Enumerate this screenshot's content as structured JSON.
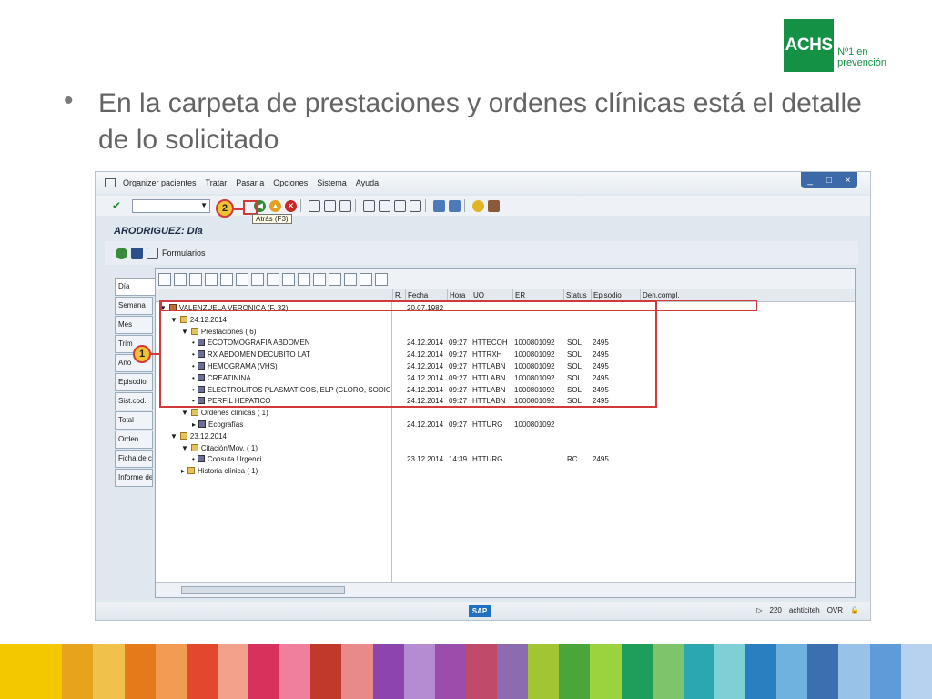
{
  "logo": {
    "mark": "ACHS",
    "line1": "Nº1 en",
    "line2": "prevención"
  },
  "slide": {
    "bullet": "•",
    "text": "En la carpeta de prestaciones y ordenes clínicas está el detalle de lo solicitado"
  },
  "sap": {
    "menu": [
      "Organizer pacientes",
      "Tratar",
      "Pasar a",
      "Opciones",
      "Sistema",
      "Ayuda"
    ],
    "window_controls": [
      "_",
      "□",
      "×"
    ],
    "tooltip": "Atrás   (F3)",
    "title": "ARODRIGUEZ: Día",
    "formularios": "Formularios",
    "markers": {
      "one": "1",
      "two": "2"
    },
    "tabs": [
      "Día",
      "Semana",
      "Mes",
      "Trim",
      "Año",
      "Episodio",
      "Sist.cod.",
      "Total",
      "Orden",
      "Ficha de c",
      "Informe de"
    ],
    "columns": [
      "R.",
      "Fecha",
      "Hora",
      "UO",
      "ER",
      "Status",
      "Episodio",
      "Den.compl."
    ],
    "rows": [
      {
        "indent": 0,
        "icon": "patient",
        "arrow": "▼",
        "label": "VALENZUELA VERONICA (F, 32)",
        "fecha": "20.07.1982",
        "hora": "",
        "uo": "",
        "er": "",
        "status": "",
        "episodio": ""
      },
      {
        "indent": 1,
        "icon": "folder",
        "arrow": "▼",
        "label": "24.12.2014",
        "fecha": "",
        "hora": "",
        "uo": "",
        "er": "",
        "status": "",
        "episodio": ""
      },
      {
        "indent": 2,
        "icon": "folder",
        "arrow": "▼",
        "label": "Prestaciones (  6)",
        "fecha": "",
        "hora": "",
        "uo": "",
        "er": "",
        "status": "",
        "episodio": ""
      },
      {
        "indent": 3,
        "icon": "doc",
        "arrow": "•",
        "label": "ECOTOMOGRAFIA ABDOMEN",
        "fecha": "24.12.2014",
        "hora": "09:27",
        "uo": "HTTECOH",
        "er": "1000801092",
        "status": "SOL",
        "episodio": "2495"
      },
      {
        "indent": 3,
        "icon": "doc",
        "arrow": "•",
        "label": "RX ABDOMEN DECUBITO LAT",
        "fecha": "24.12.2014",
        "hora": "09:27",
        "uo": "HTTRXH",
        "er": "1000801092",
        "status": "SOL",
        "episodio": "2495"
      },
      {
        "indent": 3,
        "icon": "doc",
        "arrow": "•",
        "label": "HEMOGRAMA (VHS)",
        "fecha": "24.12.2014",
        "hora": "09:27",
        "uo": "HTTLABN",
        "er": "1000801092",
        "status": "SOL",
        "episodio": "2495"
      },
      {
        "indent": 3,
        "icon": "doc",
        "arrow": "•",
        "label": "CREATININA",
        "fecha": "24.12.2014",
        "hora": "09:27",
        "uo": "HTTLABN",
        "er": "1000801092",
        "status": "SOL",
        "episodio": "2495"
      },
      {
        "indent": 3,
        "icon": "doc",
        "arrow": "•",
        "label": "ELECTROLITOS PLASMATICOS, ELP (CLORO, SODIO, PO",
        "fecha": "24.12.2014",
        "hora": "09:27",
        "uo": "HTTLABN",
        "er": "1000801092",
        "status": "SOL",
        "episodio": "2495"
      },
      {
        "indent": 3,
        "icon": "doc",
        "arrow": "•",
        "label": "PERFIL HEPATICO",
        "fecha": "24.12.2014",
        "hora": "09:27",
        "uo": "HTTLABN",
        "er": "1000801092",
        "status": "SOL",
        "episodio": "2495"
      },
      {
        "indent": 2,
        "icon": "folder",
        "arrow": "▼",
        "label": "Ordenes clínicas (  1)",
        "fecha": "",
        "hora": "",
        "uo": "",
        "er": "",
        "status": "",
        "episodio": ""
      },
      {
        "indent": 3,
        "icon": "doc",
        "arrow": "▸",
        "label": "Ecografías",
        "fecha": "24.12.2014",
        "hora": "09:27",
        "uo": "HTTURG",
        "er": "1000801092",
        "status": "",
        "episodio": ""
      },
      {
        "indent": 1,
        "icon": "folder",
        "arrow": "▼",
        "label": "23.12.2014",
        "fecha": "",
        "hora": "",
        "uo": "",
        "er": "",
        "status": "",
        "episodio": ""
      },
      {
        "indent": 2,
        "icon": "folder",
        "arrow": "▼",
        "label": "Citación/Mov. (  1)",
        "fecha": "",
        "hora": "",
        "uo": "",
        "er": "",
        "status": "",
        "episodio": ""
      },
      {
        "indent": 3,
        "icon": "doc",
        "arrow": "•",
        "label": "Consuta Urgenci",
        "fecha": "23.12.2014",
        "hora": "14:39",
        "uo": "HTTURG",
        "er": "",
        "status": "RC",
        "episodio": "2495"
      },
      {
        "indent": 2,
        "icon": "folder",
        "arrow": "▸",
        "label": "Historia clínica (  1)",
        "fecha": "",
        "hora": "",
        "uo": "",
        "er": "",
        "status": "",
        "episodio": ""
      }
    ],
    "status": {
      "sap": "SAP",
      "client": "220",
      "user": "achticiteh",
      "mode": "OVR"
    }
  },
  "colors": {
    "brand": "#159146",
    "highlight": "#d03a3a",
    "marker": "#f2c231"
  },
  "stripes": [
    "#f3c800",
    "#f3c800",
    "#e8a31c",
    "#f0c24b",
    "#e57a1a",
    "#f29b53",
    "#e3472e",
    "#f4a18c",
    "#d8315b",
    "#ef7f9c",
    "#c0392b",
    "#e88a8a",
    "#8e44ad",
    "#b58bd1",
    "#9b4dab",
    "#c04a6a",
    "#8c6bb1",
    "#a1c632",
    "#4aa63a",
    "#9bd33f",
    "#1e9e5a",
    "#7ec46a",
    "#2aa7b0",
    "#7fd0d6",
    "#2a7fc0",
    "#6fb2e0",
    "#3a6fb0",
    "#99c2e8",
    "#5e9bd8",
    "#b7d2ee"
  ]
}
